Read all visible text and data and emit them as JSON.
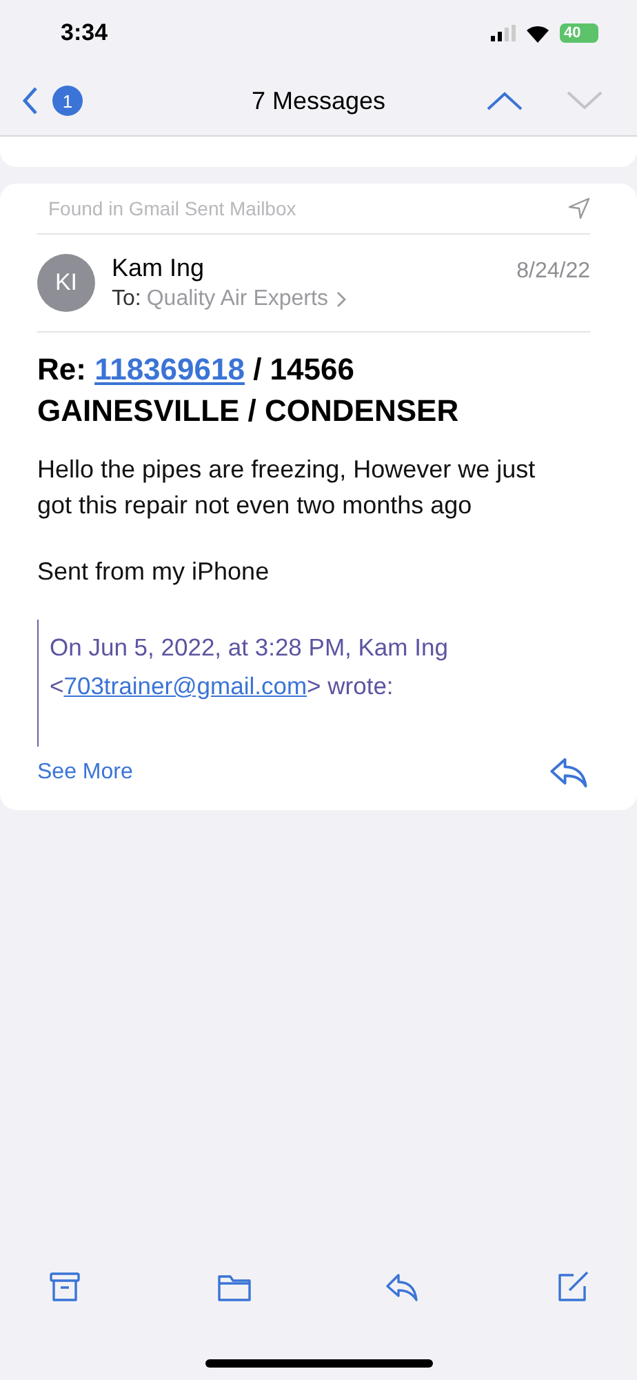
{
  "status_bar": {
    "time": "3:34",
    "battery": "40"
  },
  "nav": {
    "badge": "1",
    "title": "7 Messages",
    "arrows": [
      {
        "kind": "up",
        "disabled": false
      },
      {
        "kind": "down",
        "disabled": true
      }
    ]
  },
  "message": {
    "found_in": "Found in Gmail Sent Mailbox",
    "avatar": "KI",
    "sender": "Kam Ing",
    "to_label": "To:",
    "recipient": "Quality Air Experts",
    "date": "8/24/22",
    "subject": {
      "prefix": "Re: ",
      "link": "118369618",
      "rest": " / 14566 GAINESVILLE / CONDENSER"
    },
    "body": [
      "Hello the pipes are freezing, However we just got this repair not even two months ago",
      "Sent from my iPhone"
    ],
    "quote": {
      "before": "On Jun 5, 2022, at 3:28 PM, Kam Ing <",
      "link": "703trainer@gmail.com",
      "after": "> wrote:"
    },
    "see_more": "See More"
  },
  "toolbar": [
    {
      "kind": "archive"
    },
    {
      "kind": "folder"
    },
    {
      "kind": "reply"
    },
    {
      "kind": "compose"
    }
  ]
}
